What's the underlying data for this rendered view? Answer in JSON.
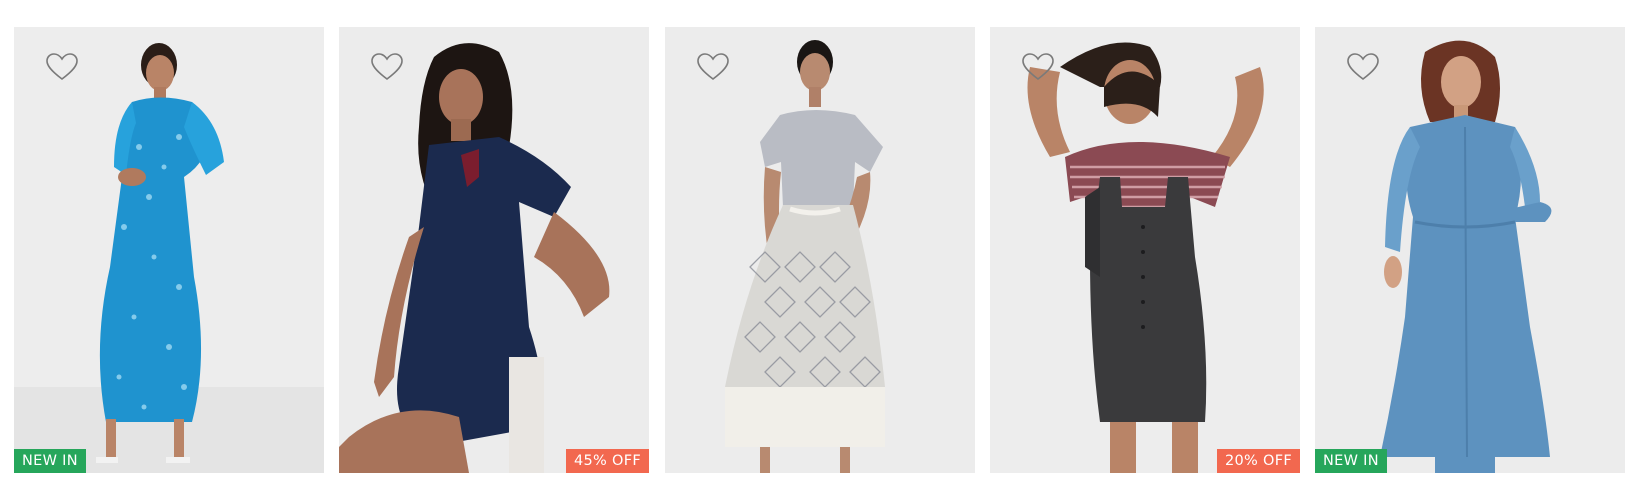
{
  "products": [
    {
      "badge": "NEW IN",
      "badge_type": "new",
      "wishlist_icon": "heart-outline-icon"
    },
    {
      "badge": "45% OFF",
      "badge_type": "off",
      "wishlist_icon": "heart-outline-icon"
    },
    {
      "badge": "",
      "badge_type": "none",
      "wishlist_icon": "heart-outline-icon"
    },
    {
      "badge": "20% OFF",
      "badge_type": "off",
      "wishlist_icon": "heart-outline-icon"
    },
    {
      "badge": "NEW IN",
      "badge_type": "new",
      "wishlist_icon": "heart-outline-icon"
    }
  ],
  "colors": {
    "card_background": "#ececec",
    "new_badge": "#26a65b",
    "discount_badge": "#f2684f",
    "heart_outline": "#7a7a7a"
  }
}
